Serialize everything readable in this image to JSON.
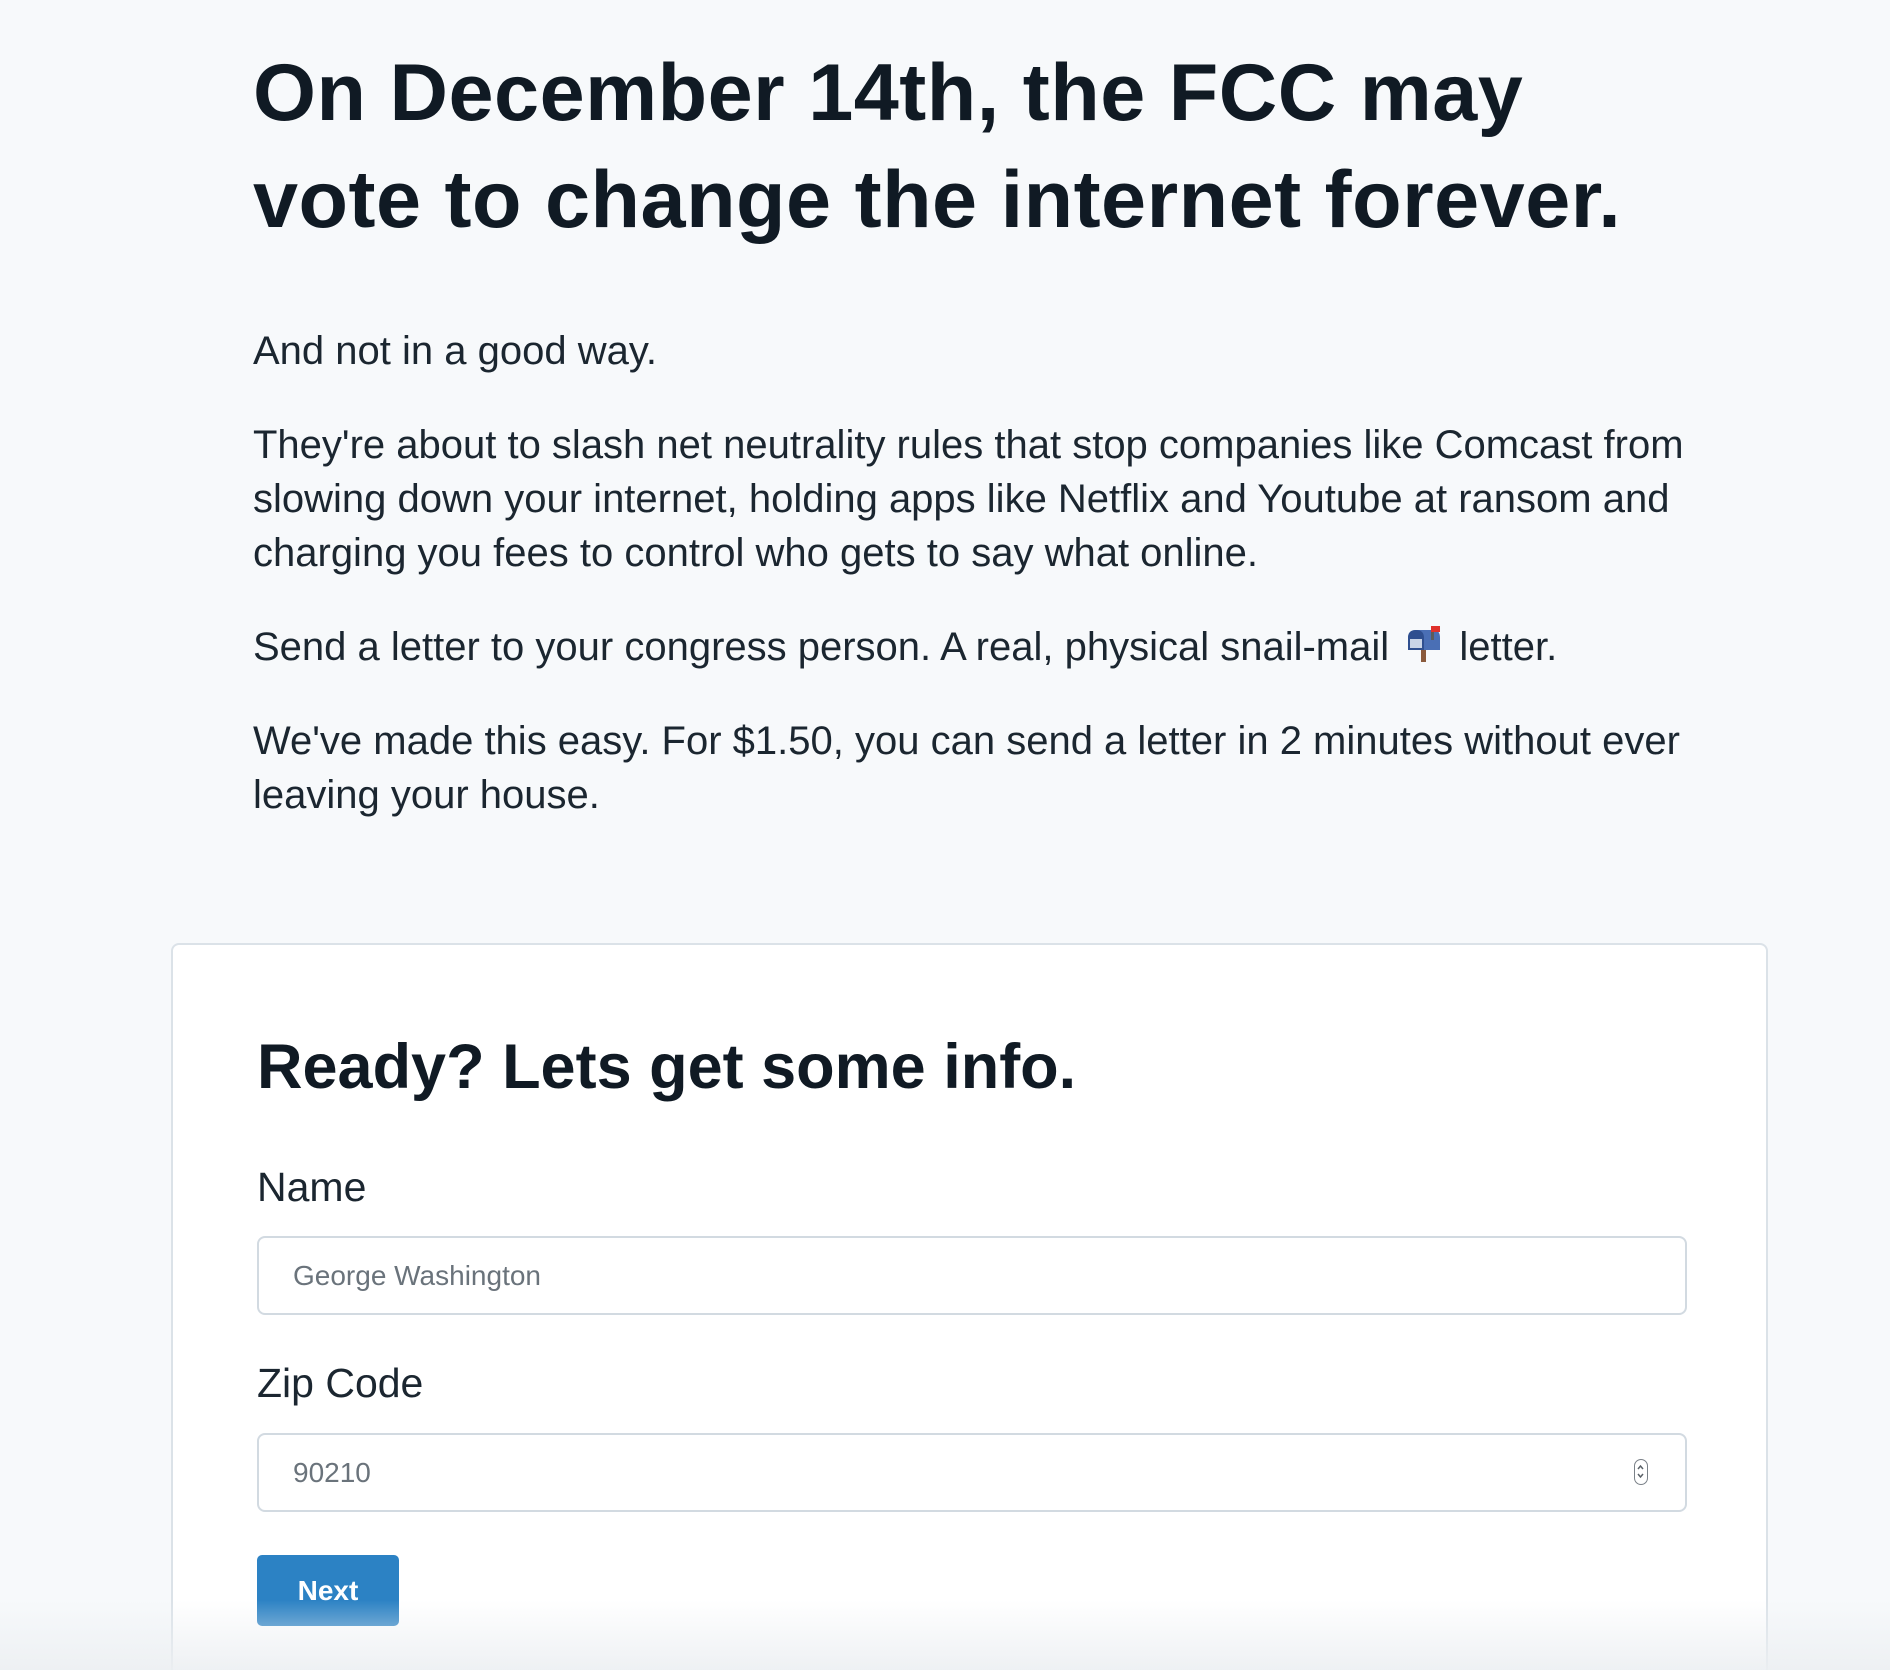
{
  "hero": {
    "title_line1": "On December 14th, the FCC may",
    "title_line2": "vote to change the internet forever.",
    "lead": "And not in a good way.",
    "paragraph1": "They're about to slash net neutrality rules that stop companies like Comcast from slowing down your internet, holding apps like Netflix and Youtube at ransom and charging you fees to control who gets to say what online.",
    "paragraph2_before": "Send a letter to your congress person. A real, physical snail-mail",
    "paragraph2_icon": "mailbox-icon",
    "paragraph2_after": "letter.",
    "paragraph3": "We've made this easy. For $1.50, you can send a letter in 2 minutes without ever leaving your house."
  },
  "form": {
    "heading": "Ready? Lets get some info.",
    "name_label": "Name",
    "name_placeholder": "George Washington",
    "zip_label": "Zip Code",
    "zip_placeholder": "90210",
    "zip_icon": "spinner-icon",
    "next_label": "Next"
  },
  "colors": {
    "background": "#f7f9fb",
    "card": "#ffffff",
    "text": "#101a24",
    "button": "#2c82c4",
    "input_border": "#d2dae1"
  }
}
